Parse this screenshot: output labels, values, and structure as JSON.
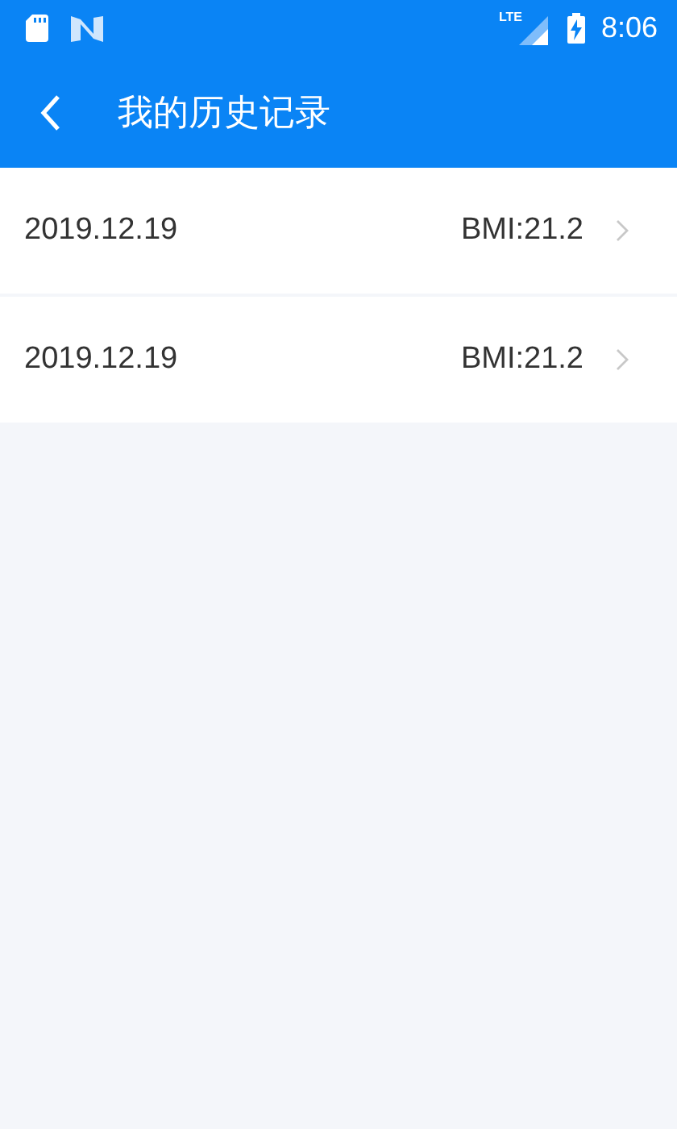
{
  "status_bar": {
    "network": "LTE",
    "time": "8:06"
  },
  "app_bar": {
    "title": "我的历史记录"
  },
  "records": [
    {
      "date": "2019.12.19",
      "value": "BMI:21.2"
    },
    {
      "date": "2019.12.19",
      "value": "BMI:21.2"
    }
  ]
}
